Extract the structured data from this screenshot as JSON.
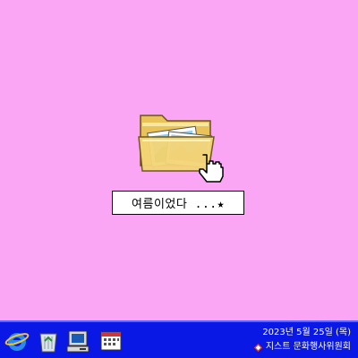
{
  "desktop": {
    "background_color": "#fba5f5",
    "folder": {
      "icon": "photo-folder-icon",
      "label": "여름이었다 ...★"
    }
  },
  "taskbar": {
    "color": "#0a18e6",
    "icons": [
      "internet-explorer-icon",
      "recycle-bin-icon",
      "my-computer-icon",
      "calendar-icon"
    ],
    "date": "2023년 5월 25일 (목)",
    "org_name": "지스트 문화행사위원회",
    "org_logo": "gist-logo-icon"
  }
}
